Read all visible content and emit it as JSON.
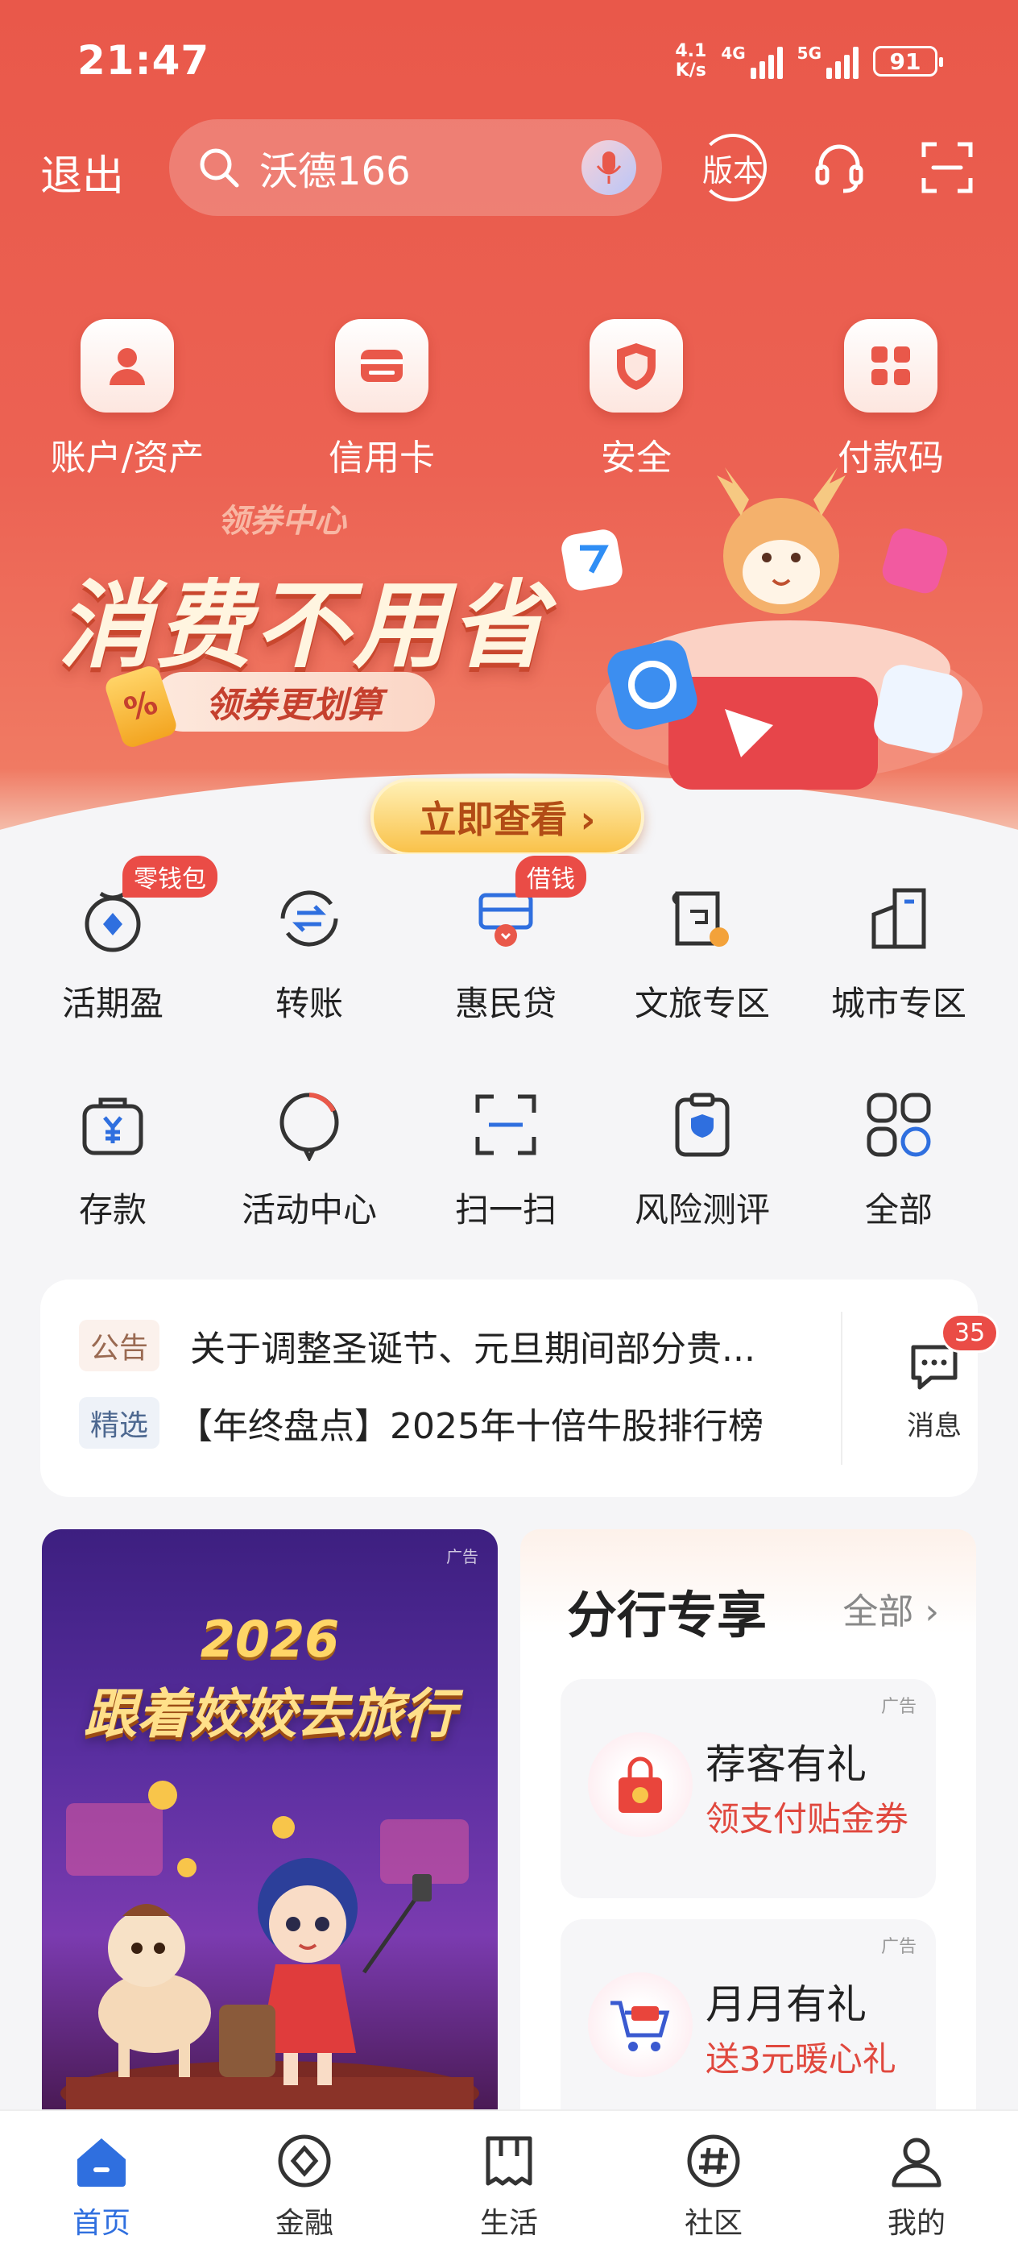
{
  "status_bar": {
    "time": "21:47",
    "net_speed_top": "4.1",
    "net_speed_bottom": "K/s",
    "signal1_tag": "4G",
    "signal2_tag": "5G",
    "battery": "91"
  },
  "header": {
    "logout_label": "退出",
    "search_text": "沃德166",
    "version_label": "版本"
  },
  "quick_actions": [
    {
      "label": "账户/资产",
      "icon": "account-icon"
    },
    {
      "label": "信用卡",
      "icon": "credit-card-icon"
    },
    {
      "label": "安全",
      "icon": "shield-icon"
    },
    {
      "label": "付款码",
      "icon": "payment-code-icon"
    }
  ],
  "banner": {
    "small_title": "领券中心",
    "title": "消费不用省",
    "pill": "领券更划算",
    "percent": "%",
    "cta": "立即查看 ›"
  },
  "functions_row1": [
    {
      "label": "活期盈",
      "badge": "零钱包",
      "icon": "piggy-icon"
    },
    {
      "label": "转账",
      "badge": "",
      "icon": "transfer-icon"
    },
    {
      "label": "惠民贷",
      "badge": "借钱",
      "icon": "loan-icon"
    },
    {
      "label": "文旅专区",
      "badge": "",
      "icon": "travel-icon"
    },
    {
      "label": "城市专区",
      "badge": "",
      "icon": "city-icon"
    }
  ],
  "functions_row2": [
    {
      "label": "存款",
      "icon": "deposit-icon"
    },
    {
      "label": "活动中心",
      "icon": "activity-icon"
    },
    {
      "label": "扫一扫",
      "icon": "scan-icon"
    },
    {
      "label": "风险测评",
      "icon": "risk-icon"
    },
    {
      "label": "全部",
      "icon": "all-apps-icon"
    }
  ],
  "notices": [
    {
      "tag": "公告",
      "text": "关于调整圣诞节、元旦期间部分贵..."
    },
    {
      "tag": "精选",
      "text": "【年终盘点】2025年十倍牛股排行榜"
    }
  ],
  "messages": {
    "label": "消息",
    "count": "35"
  },
  "ad_poster": {
    "ad_mark": "广告",
    "year": "2026",
    "title": "跟着姣姣去旅行"
  },
  "branch": {
    "title": "分行专享",
    "all_label": "全部 ›",
    "promos": [
      {
        "ad": "广告",
        "title": "荐客有礼",
        "subtitle": "领支付贴金券"
      },
      {
        "ad": "广告",
        "title": "月月有礼",
        "subtitle": "送3元暖心礼"
      }
    ]
  },
  "bottom_nav": [
    {
      "label": "首页",
      "icon": "home-icon",
      "active": true
    },
    {
      "label": "金融",
      "icon": "finance-icon",
      "active": false
    },
    {
      "label": "生活",
      "icon": "life-icon",
      "active": false
    },
    {
      "label": "社区",
      "icon": "community-icon",
      "active": false
    },
    {
      "label": "我的",
      "icon": "profile-icon",
      "active": false
    }
  ],
  "colors": {
    "brand_red": "#e9584a",
    "accent_blue": "#2f6fdf",
    "badge_red": "#ea4c46"
  }
}
